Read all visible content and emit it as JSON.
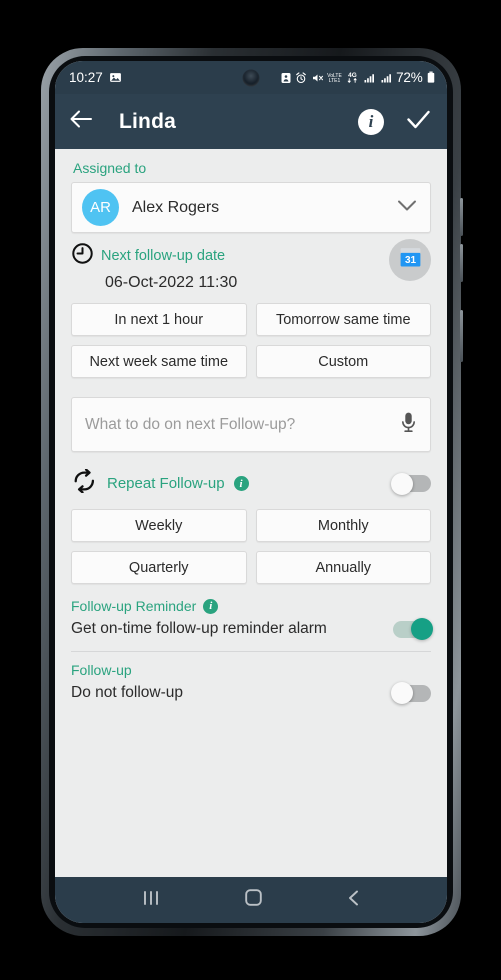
{
  "status_bar": {
    "time": "10:27",
    "battery_percent": "72%",
    "icons_left": [
      "photo-icon"
    ],
    "icons_right": [
      "app-notification-icon",
      "alarm-icon",
      "volume-mute-icon",
      "volte-icon",
      "4g-data-icon",
      "signal-sim1-icon",
      "signal-sim2-icon"
    ],
    "network_labels": {
      "volte": "VoLTE",
      "data": "4G"
    }
  },
  "app_bar": {
    "title": "Linda",
    "back_icon": "back-arrow-icon",
    "info_icon": "info-icon",
    "confirm_icon": "check-icon"
  },
  "assigned_to": {
    "label": "Assigned to",
    "avatar_initials": "AR",
    "name": "Alex Rogers",
    "avatar_color": "#4fc3f2",
    "chevron_icon": "chevron-down-icon"
  },
  "next_followup": {
    "label": "Next follow-up date",
    "clock_icon": "clock-icon",
    "date_value": "06-Oct-2022 11:30",
    "calendar_icon": "calendar-icon",
    "calendar_day": "31",
    "quick_options": [
      "In next 1 hour",
      "Tomorrow same time",
      "Next week same time",
      "Custom"
    ]
  },
  "note": {
    "placeholder": "What to do on next Follow-up?",
    "value": "",
    "mic_icon": "microphone-icon"
  },
  "repeat_followup": {
    "label": "Repeat Follow-up",
    "repeat_icon": "repeat-icon",
    "info_icon": "info-icon",
    "info_glyph": "i",
    "toggle_state": "off",
    "frequencies": [
      "Weekly",
      "Monthly",
      "Quarterly",
      "Annually"
    ]
  },
  "followup_reminder": {
    "label": "Follow-up Reminder",
    "info_glyph": "i",
    "description": "Get on-time follow-up reminder alarm",
    "toggle_state": "on"
  },
  "followup_setting": {
    "label": "Follow-up",
    "description": "Do not follow-up",
    "toggle_state": "off"
  },
  "nav_bar": {
    "recents_icon": "recents-icon",
    "home_icon": "home-icon",
    "back_icon": "back-icon"
  },
  "colors": {
    "accent_teal": "#2aa37f",
    "toggle_on": "#16a085",
    "app_bar": "#2e4150",
    "status_bar": "#2b3d4b",
    "page_bg": "#eceded",
    "avatar_blue": "#4fc3f2",
    "calendar_blue": "#2196f3"
  }
}
